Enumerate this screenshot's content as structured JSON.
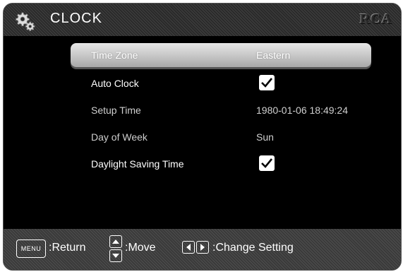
{
  "header": {
    "title": "CLOCK",
    "brand": "RCA",
    "icon": "gear-icon"
  },
  "settings": [
    {
      "label": "Time Zone",
      "value": "Eastern",
      "selected": true
    },
    {
      "label": "Auto Clock",
      "checked": true
    },
    {
      "label": "Setup Time",
      "value": "1980-01-06 18:49:24"
    },
    {
      "label": "Day of Week",
      "value": "Sun"
    },
    {
      "label": "Daylight Saving Time",
      "checked": true
    }
  ],
  "footer": {
    "menu_key": "MENU",
    "return_label": ":Return",
    "move_label": ":Move",
    "change_label": ":Change Setting"
  }
}
